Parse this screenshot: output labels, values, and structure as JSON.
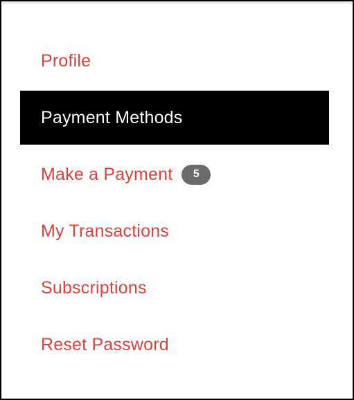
{
  "colors": {
    "link": "#e0403a",
    "active_bg": "#000000",
    "active_text": "#ffffff",
    "badge_bg": "#6b6b6b",
    "badge_text": "#ffffff"
  },
  "menu": {
    "items": [
      {
        "id": "profile",
        "label": "Profile",
        "active": false
      },
      {
        "id": "payment-methods",
        "label": "Payment Methods",
        "active": true
      },
      {
        "id": "make-a-payment",
        "label": "Make a Payment",
        "active": false,
        "badge": "5"
      },
      {
        "id": "my-transactions",
        "label": "My Transactions",
        "active": false
      },
      {
        "id": "subscriptions",
        "label": "Subscriptions",
        "active": false
      },
      {
        "id": "reset-password",
        "label": "Reset Password",
        "active": false
      }
    ]
  }
}
